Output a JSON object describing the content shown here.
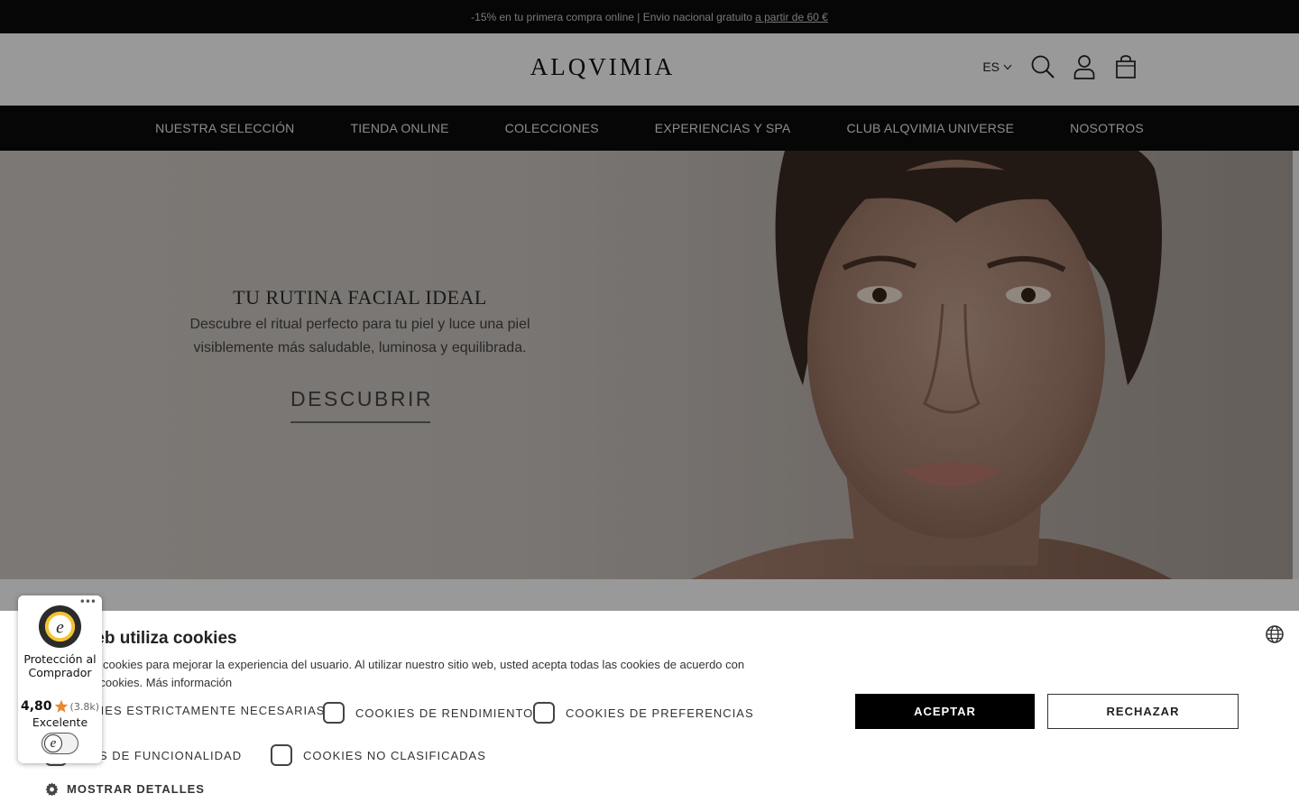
{
  "topbar": {
    "promo_text": "-15% en tu primera compra online | Envio nacional gratuito",
    "promo_link": "a partir de 60 €"
  },
  "header": {
    "logo": "ALQVIMIA",
    "language": "ES"
  },
  "nav": {
    "items": [
      {
        "label": "NUESTRA SELECCIÓN"
      },
      {
        "label": "TIENDA ONLINE"
      },
      {
        "label": "COLECCIONES"
      },
      {
        "label": "EXPERIENCIAS Y SPA"
      },
      {
        "label": "CLUB ALQVIMIA UNIVERSE"
      },
      {
        "label": "NOSOTROS"
      }
    ]
  },
  "hero": {
    "title": "TU RUTINA FACIAL IDEAL",
    "subtitle_line1": "Descubre el ritual perfecto para tu piel y luce una piel",
    "subtitle_line2": "visiblemente  más saludable,  luminosa y equilibrada.",
    "cta": "DESCUBRIR"
  },
  "cookie_banner": {
    "title": "tio web utiliza cookies",
    "text_line1": "web usa cookies para mejorar la experiencia del usuario. Al utilizar nuestro sitio web, usted acepta todas las cookies de acuerdo con",
    "text_line2": "lítica de cookies.",
    "more_info": "Más información",
    "options": [
      {
        "label": "KIES ESTRICTAMENTE NECESARIAS"
      },
      {
        "label": "COOKIES DE RENDIMIENTO"
      },
      {
        "label": "COOKIES DE PREFERENCIAS"
      },
      {
        "label": "KIES DE FUNCIONALIDAD"
      },
      {
        "label": "COOKIES NO CLASIFICADAS"
      }
    ],
    "accept": "ACEPTAR",
    "reject": "RECHAZAR",
    "show_details": "MOSTRAR DETALLES"
  },
  "trusted_shops": {
    "label": "Protección al Comprador",
    "score": "4,80",
    "count": "(3.8k)",
    "grade": "Excelente"
  },
  "colors": {
    "topbar_bg": "#0b0b0b",
    "nav_bg": "#0b0b0b",
    "accept_bg": "#000000",
    "rating_star": "#e8882f"
  }
}
